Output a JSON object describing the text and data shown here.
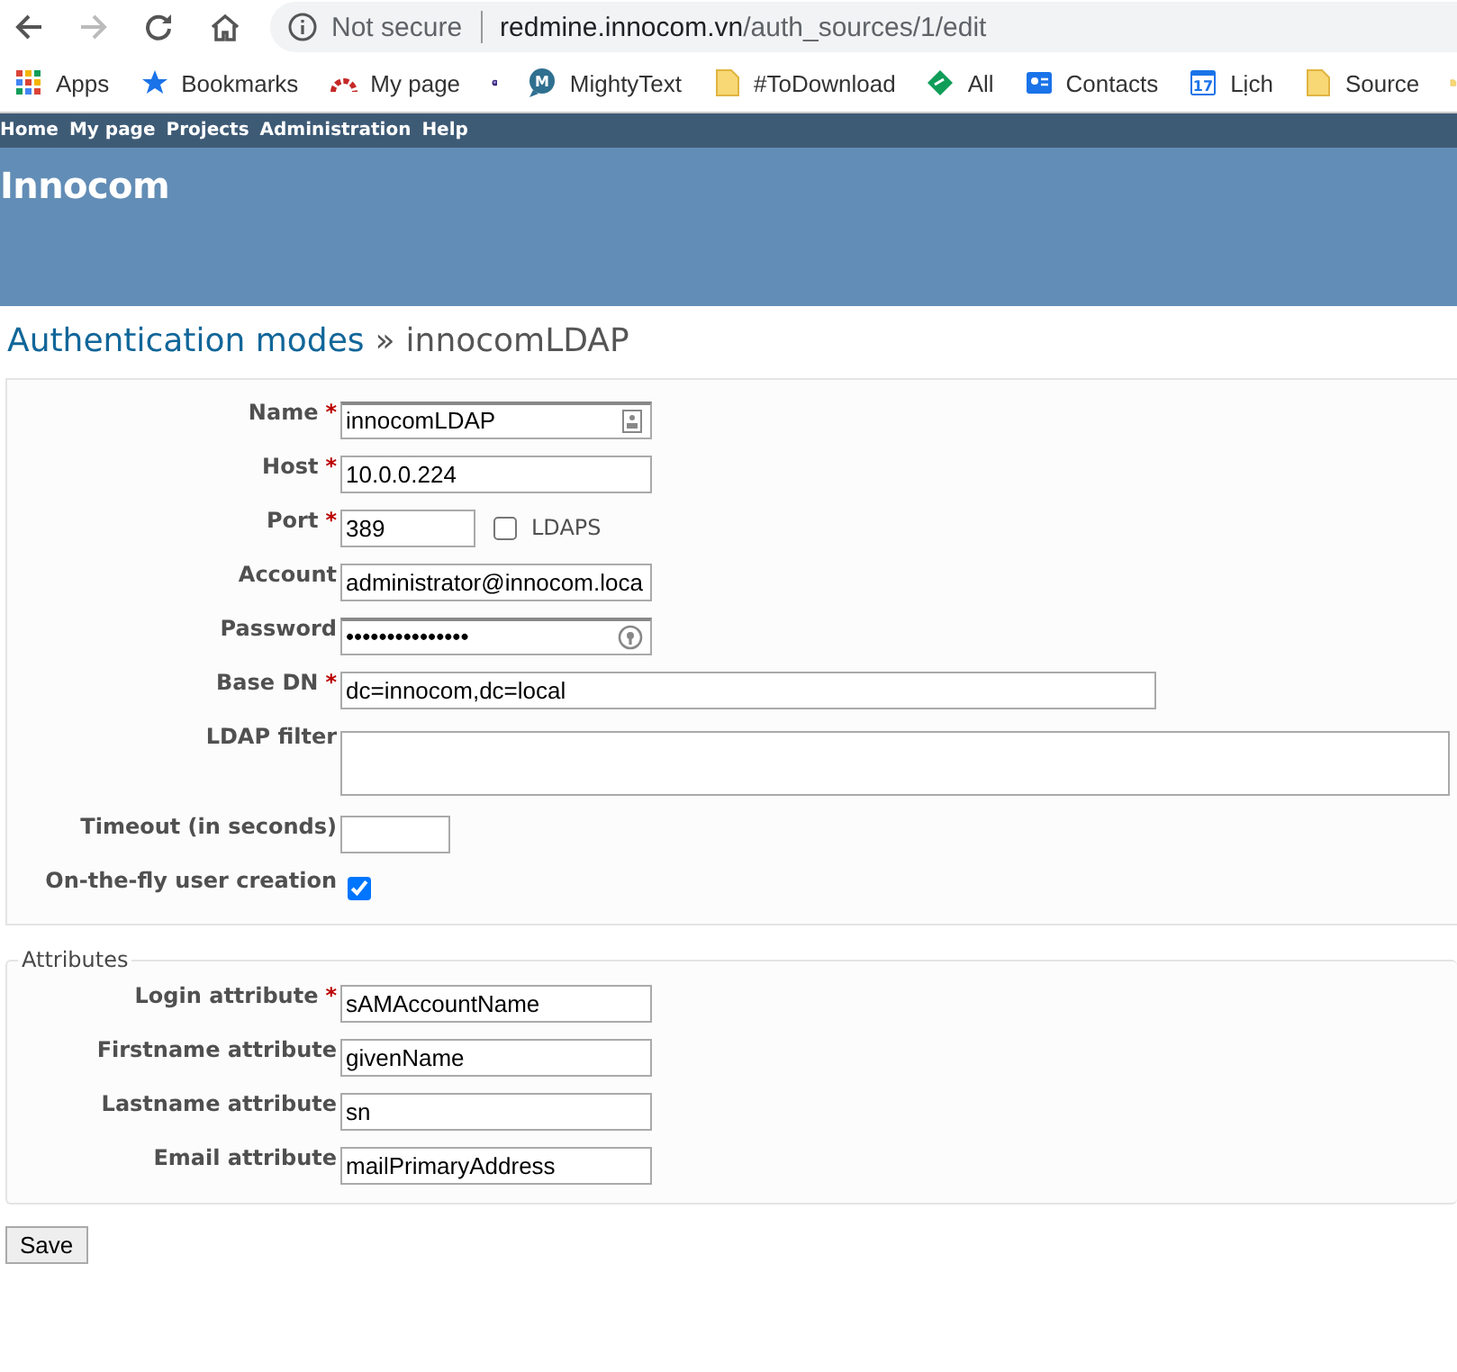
{
  "browser": {
    "security_label": "Not secure",
    "url_host": "redmine.innocom.vn",
    "url_path": "/auth_sources/1/edit",
    "bookmarks": [
      {
        "kind": "apps",
        "label": "Apps"
      },
      {
        "kind": "star",
        "label": "Bookmarks"
      },
      {
        "kind": "gauge",
        "label": "My page"
      },
      {
        "kind": "orb"
      },
      {
        "kind": "bubble",
        "label": "MightyText",
        "icon_text": "M"
      },
      {
        "kind": "folder",
        "label": "#ToDownload"
      },
      {
        "kind": "leaf",
        "label": "All"
      },
      {
        "kind": "contacts",
        "label": "Contacts"
      },
      {
        "kind": "calendar",
        "label": "Lịch",
        "icon_text": "17"
      },
      {
        "kind": "folder",
        "label": "Source"
      },
      {
        "kind": "folder"
      }
    ]
  },
  "top_menu": [
    "Home",
    "My page",
    "Projects",
    "Administration",
    "Help"
  ],
  "header": {
    "title": "Innocom"
  },
  "heading": {
    "link": "Authentication modes",
    "separator": "»",
    "current": "innocomLDAP"
  },
  "main_fields": [
    {
      "kind": "autofill",
      "label": "Name",
      "required_mark": "*",
      "value": "innocomLDAP"
    },
    {
      "kind": "text",
      "label": "Host",
      "required_mark": "*",
      "value": "10.0.0.224"
    },
    {
      "kind": "port",
      "label": "Port",
      "required_mark": "*",
      "value": "389",
      "option": {
        "label": "LDAPS",
        "checked": false
      }
    },
    {
      "kind": "text",
      "label": "Account",
      "value": "administrator@innocom.loca"
    },
    {
      "kind": "password",
      "label": "Password",
      "value": "•••••••••••••••"
    },
    {
      "kind": "long",
      "label": "Base DN",
      "required_mark": "*",
      "value": "dc=innocom,dc=local"
    },
    {
      "kind": "textarea",
      "label": "LDAP filter"
    },
    {
      "kind": "small",
      "label": "Timeout (in seconds)"
    },
    {
      "kind": "checkbox",
      "label": "On-the-fly user creation",
      "checked": true
    }
  ],
  "attributes": {
    "legend": "Attributes",
    "fields": [
      {
        "kind": "text",
        "label": "Login attribute",
        "required_mark": "*",
        "value": "sAMAccountName"
      },
      {
        "kind": "text",
        "label": "Firstname attribute",
        "value": "givenName"
      },
      {
        "kind": "text",
        "label": "Lastname attribute",
        "value": "sn"
      },
      {
        "kind": "text",
        "label": "Email attribute",
        "value": "mailPrimaryAddress"
      }
    ]
  },
  "save_button": "Save"
}
